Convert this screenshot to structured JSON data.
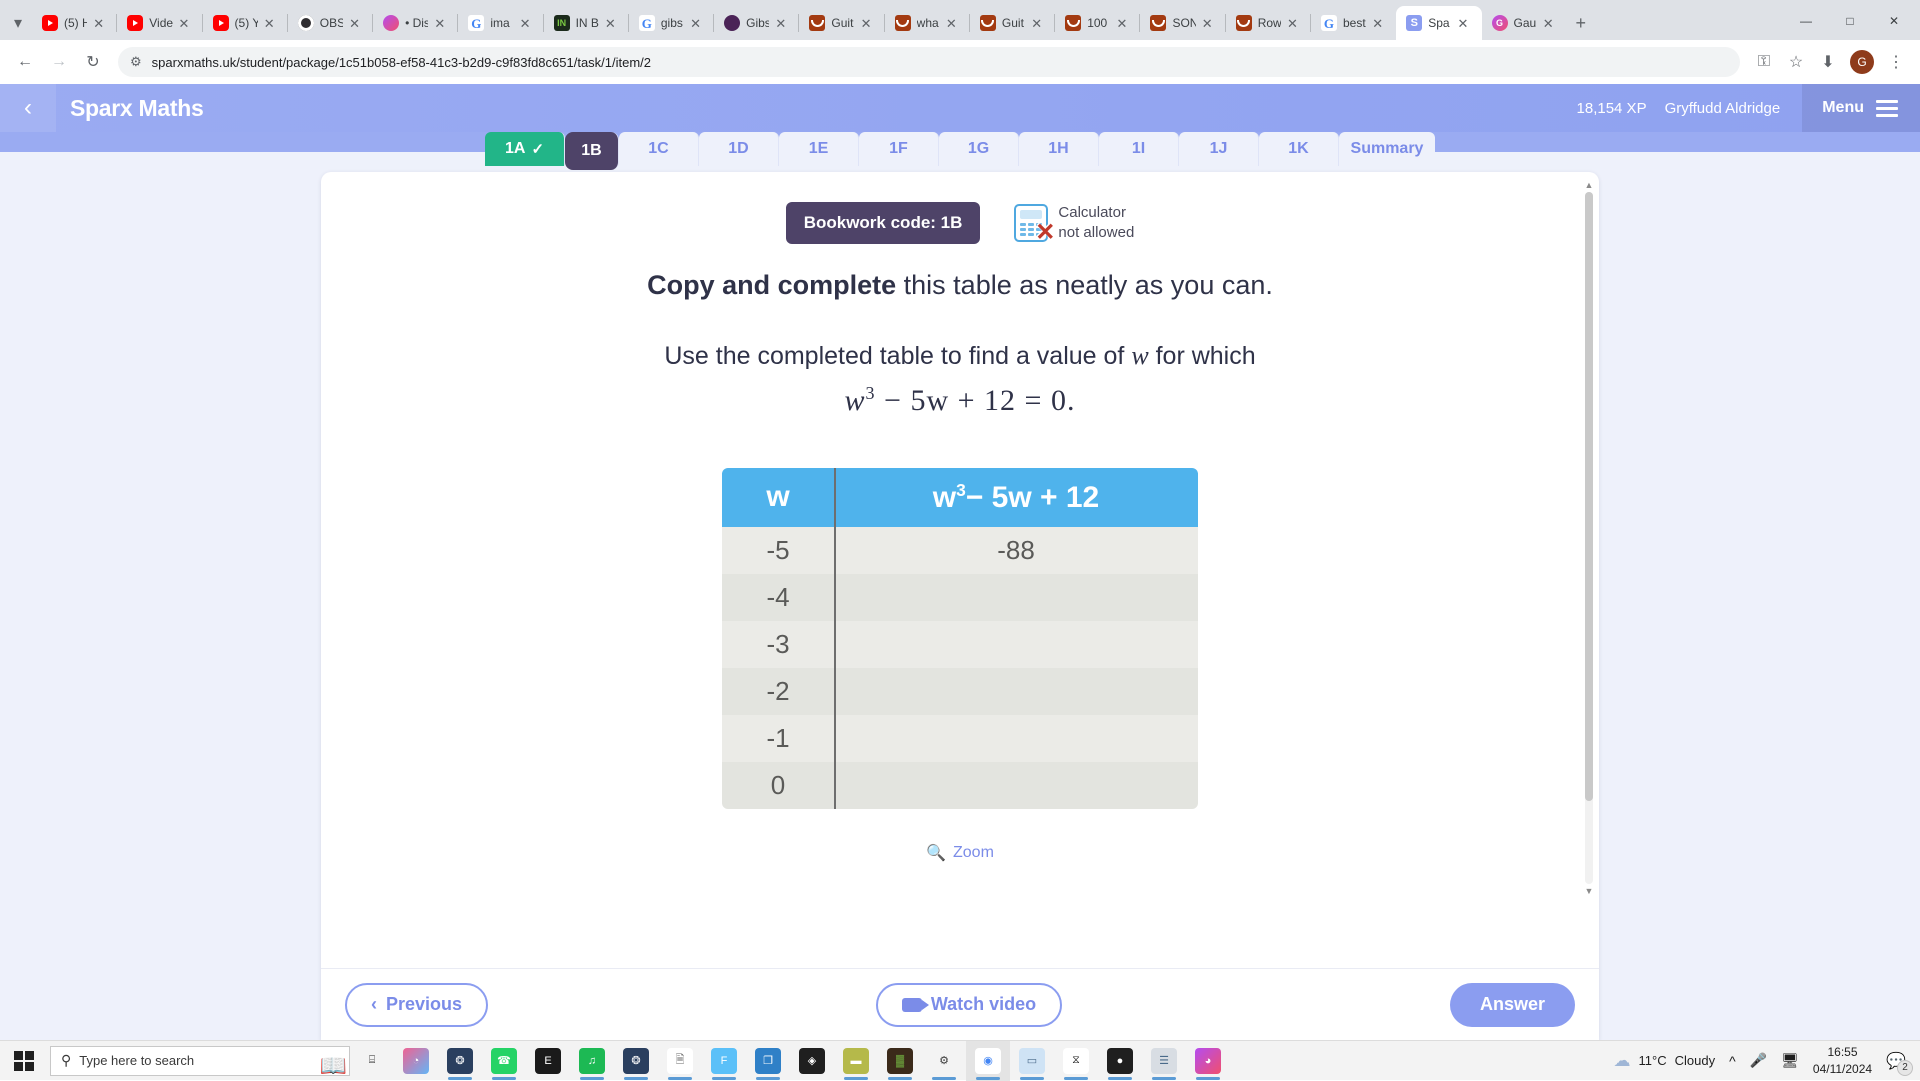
{
  "browser": {
    "tabs": [
      {
        "title": "(5) H",
        "favicon": "youtube-icon",
        "active": false
      },
      {
        "title": "Vide",
        "favicon": "youtube-icon",
        "active": false
      },
      {
        "title": "(5) Y",
        "favicon": "youtube-icon",
        "active": false
      },
      {
        "title": "OBS",
        "favicon": "obs-icon",
        "active": false
      },
      {
        "title": "• Dis",
        "favicon": "discord-icon",
        "active": false
      },
      {
        "title": "ima",
        "favicon": "google-icon",
        "active": false
      },
      {
        "title": "IN B",
        "favicon": "dark-icon",
        "active": false
      },
      {
        "title": "gibs",
        "favicon": "google-icon",
        "active": false
      },
      {
        "title": "Gibs",
        "favicon": "purple-icon",
        "active": false
      },
      {
        "title": "Guit",
        "favicon": "ultimate-guitar-icon",
        "active": false
      },
      {
        "title": "wha",
        "favicon": "ultimate-guitar-icon",
        "active": false
      },
      {
        "title": "Guit",
        "favicon": "ultimate-guitar-icon",
        "active": false
      },
      {
        "title": "100",
        "favicon": "ultimate-guitar-icon",
        "active": false
      },
      {
        "title": "SON",
        "favicon": "ultimate-guitar-icon",
        "active": false
      },
      {
        "title": "Row",
        "favicon": "ultimate-guitar-icon",
        "active": false
      },
      {
        "title": "best",
        "favicon": "google-icon",
        "active": false
      },
      {
        "title": "Spa",
        "favicon": "sparx-icon",
        "active": true
      },
      {
        "title": "Gau",
        "favicon": "gauth-icon",
        "active": false
      }
    ],
    "new_tab_label": "+",
    "window_controls": {
      "minimize": "—",
      "maximize": "□",
      "close": "✕"
    },
    "url": "sparxmaths.uk/student/package/1c51b058-ef58-41c3-b2d9-c9f83fd8c651/task/1/item/2",
    "profile_initial": "G"
  },
  "app_header": {
    "back_label": "‹",
    "title": "Sparx Maths",
    "xp": "18,154 XP",
    "username": "Gryffudd Aldridge",
    "menu_label": "Menu"
  },
  "task_tabs": [
    {
      "label": "1A",
      "state": "done",
      "check": "✓"
    },
    {
      "label": "1B",
      "state": "active",
      "check": ""
    },
    {
      "label": "1C",
      "state": "normal",
      "check": ""
    },
    {
      "label": "1D",
      "state": "normal",
      "check": ""
    },
    {
      "label": "1E",
      "state": "normal",
      "check": ""
    },
    {
      "label": "1F",
      "state": "normal",
      "check": ""
    },
    {
      "label": "1G",
      "state": "normal",
      "check": ""
    },
    {
      "label": "1H",
      "state": "normal",
      "check": ""
    },
    {
      "label": "1I",
      "state": "normal",
      "check": ""
    },
    {
      "label": "1J",
      "state": "normal",
      "check": ""
    },
    {
      "label": "1K",
      "state": "normal",
      "check": ""
    },
    {
      "label": "Summary",
      "state": "normal",
      "check": ""
    }
  ],
  "question": {
    "bookwork_code": "Bookwork code: 1B",
    "calculator_line1": "Calculator",
    "calculator_line2": "not allowed",
    "prompt_bold": "Copy and complete",
    "prompt_rest": " this table as neatly as you can.",
    "instruction_pre": "Use the completed table to find a value of ",
    "instruction_var": "w",
    "instruction_post": " for which",
    "equation_base": "w",
    "equation_exp": "3",
    "equation_rest": " − 5w + 12 = 0.",
    "zoom_label": "Zoom"
  },
  "table": {
    "header_col1": "w",
    "header_col2_base": "w",
    "header_col2_exp": "3",
    "header_col2_rest": "− 5w + 12",
    "rows": [
      {
        "w": "-5",
        "value": "-88"
      },
      {
        "w": "-4",
        "value": ""
      },
      {
        "w": "-3",
        "value": ""
      },
      {
        "w": "-2",
        "value": ""
      },
      {
        "w": "-1",
        "value": ""
      },
      {
        "w": "0",
        "value": ""
      }
    ]
  },
  "footer": {
    "previous_label": "Previous",
    "watch_video_label": "Watch video",
    "answer_label": "Answer"
  },
  "taskbar": {
    "search_placeholder": "Type here to search",
    "weather_temp": "11°C",
    "weather_desc": "Cloudy",
    "time": "16:55",
    "date": "04/11/2024",
    "notification_count": "2",
    "apps": [
      {
        "name": "task-view-icon",
        "glyph": "⌸",
        "bg": "transparent",
        "color": "#1f1f1f",
        "running": false
      },
      {
        "name": "copilot-icon",
        "glyph": "◔",
        "bg": "linear-gradient(135deg,#f06292,#64b5f6)",
        "color": "#fff",
        "running": false
      },
      {
        "name": "steam-icon",
        "glyph": "❂",
        "bg": "#2a3f5f",
        "color": "#fff",
        "running": true
      },
      {
        "name": "whatsapp-icon",
        "glyph": "☎",
        "bg": "#25d366",
        "color": "#fff",
        "running": true
      },
      {
        "name": "epic-games-icon",
        "glyph": "E",
        "bg": "#1a1a1a",
        "color": "#fff",
        "running": false
      },
      {
        "name": "spotify-icon",
        "glyph": "♫",
        "bg": "#1db954",
        "color": "#fff",
        "running": true
      },
      {
        "name": "steam-icon",
        "glyph": "❂",
        "bg": "#2a3f5f",
        "color": "#fff",
        "running": true
      },
      {
        "name": "file-explorer-icon",
        "glyph": "🗎",
        "bg": "#fff",
        "color": "#666",
        "running": true
      },
      {
        "name": "fortnite-icon",
        "glyph": "F",
        "bg": "#5bc0f8",
        "color": "#fff",
        "running": true
      },
      {
        "name": "remote-desktop-icon",
        "glyph": "❐",
        "bg": "#2f80c7",
        "color": "#fff",
        "running": true
      },
      {
        "name": "affinity-icon",
        "glyph": "◈",
        "bg": "#1f1f1f",
        "color": "#fff",
        "running": false
      },
      {
        "name": "folder-icon",
        "glyph": "▬",
        "bg": "#b5b94a",
        "color": "#fff",
        "running": true
      },
      {
        "name": "minecraft-icon",
        "glyph": "▓",
        "bg": "#3b2a1a",
        "color": "#6a9c3b",
        "running": true
      },
      {
        "name": "settings-icon",
        "glyph": "⚙",
        "bg": "transparent",
        "color": "#3a3a3a",
        "running": true
      },
      {
        "name": "chrome-icon",
        "glyph": "◉",
        "bg": "#fff",
        "color": "#4285f4",
        "running": true
      },
      {
        "name": "notepad-icon",
        "glyph": "▭",
        "bg": "#cfe3f5",
        "color": "#4a6a8a",
        "running": true
      },
      {
        "name": "capcut-icon",
        "glyph": "⧖",
        "bg": "#fff",
        "color": "#1f1f1f",
        "running": true
      },
      {
        "name": "obs-icon",
        "glyph": "●",
        "bg": "#1f1f1f",
        "color": "#fff",
        "running": true
      },
      {
        "name": "task-manager-icon",
        "glyph": "☰",
        "bg": "#d8dde3",
        "color": "#4a6a8a",
        "running": true
      },
      {
        "name": "discord-icon",
        "glyph": "◕",
        "bg": "linear-gradient(135deg,#b44cf0,#f0506e)",
        "color": "#fff",
        "running": true
      }
    ]
  }
}
